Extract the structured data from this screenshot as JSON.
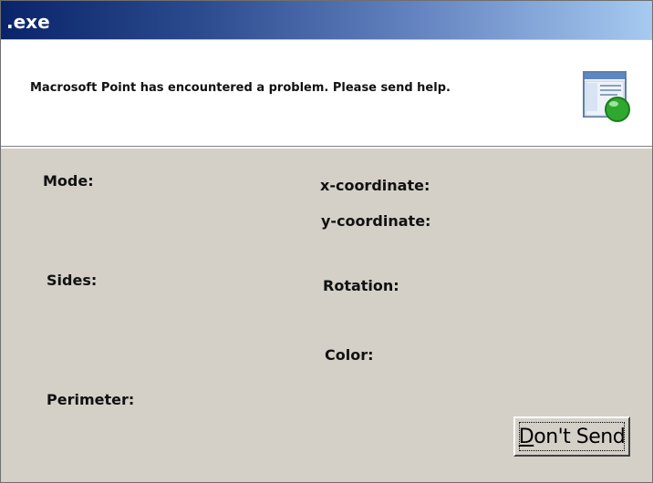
{
  "window": {
    "title": ".exe"
  },
  "header": {
    "message": "Macrosoft Point has encountered a problem. Please send help.",
    "icon": "application-window-icon"
  },
  "fields": {
    "mode_label": "Mode:",
    "x_coordinate_label": "x-coordinate:",
    "y_coordinate_label": "y-coordinate:",
    "sides_label": "Sides:",
    "rotation_label": "Rotation:",
    "color_label": "Color:",
    "perimeter_label": "Perimeter:"
  },
  "actions": {
    "dont_send_first": "D",
    "dont_send_rest": "on't Send"
  },
  "colors": {
    "titlebar_start": "#0a246a",
    "titlebar_end": "#a6caf0",
    "dialog_background": "#d4d0c8",
    "icon_green": "#2fa82f"
  }
}
